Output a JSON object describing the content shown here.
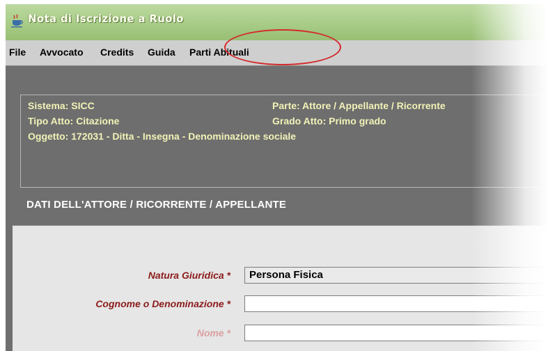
{
  "window": {
    "title": "Nota di Iscrizione a Ruolo"
  },
  "menu": {
    "items": [
      "File",
      "Avvocato",
      "Credits",
      "Guida",
      "Parti Abituali"
    ]
  },
  "info": {
    "sistema": "Sistema: SICC",
    "parte": "Parte: Attore / Appellante / Ricorrente",
    "tipo_atto": "Tipo Atto: Citazione",
    "grado_atto": "Grado Atto: Primo grado",
    "oggetto": "Oggetto: 172031 - Ditta - Insegna - Denominazione sociale"
  },
  "section": {
    "title": "DATI DELL'ATTORE / RICORRENTE / APPELLANTE"
  },
  "form": {
    "natura_label": "Natura Giuridica *",
    "natura_value": "Persona Fisica",
    "cognome_label": "Cognome o Denominazione *",
    "cognome_value": "",
    "nome_label": "Nome *",
    "nome_value": ""
  },
  "colors": {
    "label_required": "#8b1a1a",
    "label_disabled": "#d9a0a0",
    "info_text": "#f2f2b8",
    "highlight": "#d42a2a"
  },
  "icons": {
    "app": "java-coffee-icon"
  }
}
